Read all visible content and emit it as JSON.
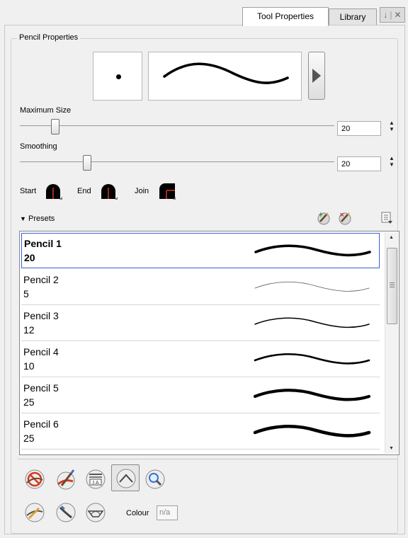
{
  "tabs": [
    {
      "label": "Tool Properties",
      "active": true
    },
    {
      "label": "Library",
      "active": false
    }
  ],
  "panel_controls": {
    "menu_icon": "arrow-down-icon",
    "close_icon": "close-icon"
  },
  "pencil_properties": {
    "title": "Pencil Properties",
    "maximum_size": {
      "label": "Maximum Size",
      "value": "20",
      "fraction": 0.1
    },
    "smoothing": {
      "label": "Smoothing",
      "value": "20",
      "fraction": 0.2
    },
    "start_label": "Start",
    "end_label": "End",
    "join_label": "Join"
  },
  "presets": {
    "label": "Presets",
    "items": [
      {
        "name": "Pencil 1",
        "size": "20",
        "selected": true,
        "stroke": 3.6
      },
      {
        "name": "Pencil 2",
        "size": "5",
        "selected": false,
        "stroke": 0.8
      },
      {
        "name": "Pencil 3",
        "size": "12",
        "selected": false,
        "stroke": 1.5
      },
      {
        "name": "Pencil 4",
        "size": "10",
        "selected": false,
        "stroke": 2.6
      },
      {
        "name": "Pencil 5",
        "size": "25",
        "selected": false,
        "stroke": 4.2
      },
      {
        "name": "Pencil 6",
        "size": "25",
        "selected": false,
        "stroke": 4.6
      },
      {
        "name": "",
        "size": "",
        "selected": false,
        "stroke": 3
      }
    ]
  },
  "colour": {
    "label": "Colour",
    "value": "n/a"
  },
  "colors": {
    "accent": "#3c5fd6",
    "icon_red": "#d33a1e",
    "icon_blue": "#3a6fd0"
  }
}
